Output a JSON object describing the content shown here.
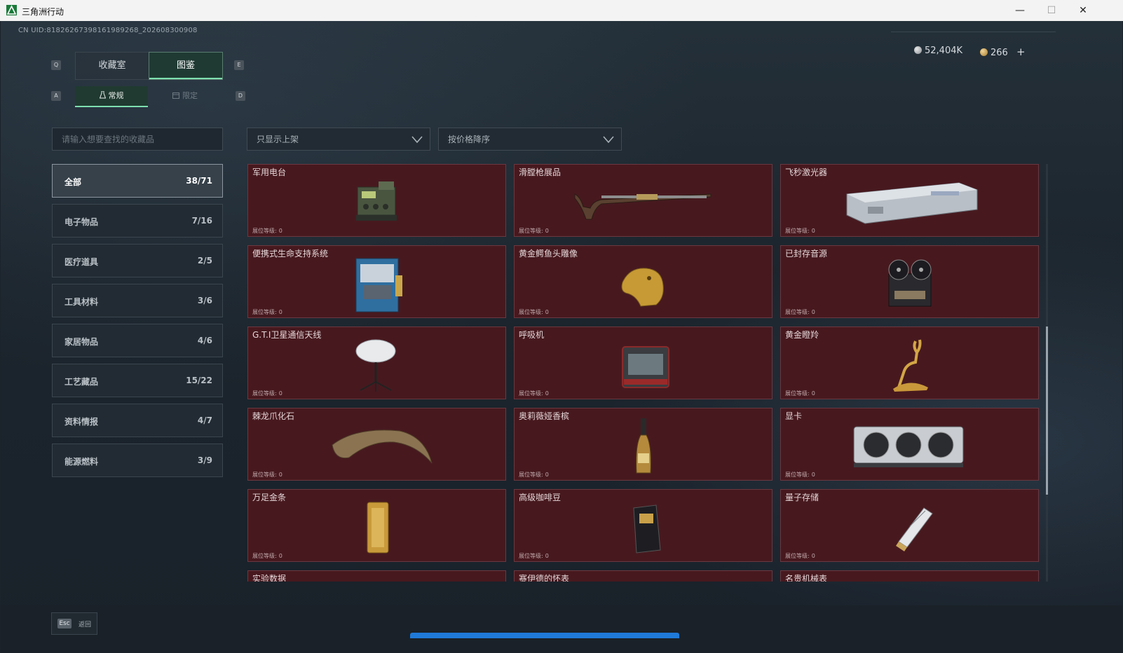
{
  "window": {
    "title": "三角洲行动",
    "minimize": "—",
    "maximize": "☐",
    "close": "✕"
  },
  "header": {
    "uid": "CN UID:818262673981619892​68_202608300908",
    "silver": "52,404K",
    "gold": "266",
    "add": "+"
  },
  "keys": {
    "q": "Q",
    "e": "E",
    "a": "A",
    "d": "D"
  },
  "tabs": [
    {
      "label": "收藏室"
    },
    {
      "label": "图鉴"
    }
  ],
  "subtabs": [
    {
      "label": "常规"
    },
    {
      "label": "限定"
    }
  ],
  "search": {
    "placeholder": "请输入想要查找的收藏品"
  },
  "filters": {
    "shelf": "只显示上架",
    "sort": "按价格降序"
  },
  "categories": [
    {
      "label": "全部",
      "count": "38/71"
    },
    {
      "label": "电子物品",
      "count": "7/16"
    },
    {
      "label": "医疗道具",
      "count": "2/5"
    },
    {
      "label": "工具材料",
      "count": "3/6"
    },
    {
      "label": "家居物品",
      "count": "4/6"
    },
    {
      "label": "工艺藏品",
      "count": "15/22"
    },
    {
      "label": "资料情报",
      "count": "4/7"
    },
    {
      "label": "能源燃料",
      "count": "3/9"
    }
  ],
  "level_label": "展位等级:",
  "items": [
    {
      "name": "军用电台",
      "level": "0"
    },
    {
      "name": "滑膛枪展品",
      "level": "0"
    },
    {
      "name": "飞秒激光器",
      "level": "0"
    },
    {
      "name": "便携式生命支持系统",
      "level": "0"
    },
    {
      "name": "黄金鳄鱼头雕像",
      "level": "0"
    },
    {
      "name": "已封存音源",
      "level": "0"
    },
    {
      "name": "G.T.I卫星通信天线",
      "level": "0"
    },
    {
      "name": "呼吸机",
      "level": "0"
    },
    {
      "name": "黄金瞪羚",
      "level": "0"
    },
    {
      "name": "棘龙爪化石",
      "level": "0"
    },
    {
      "name": "奥莉薇娅香槟",
      "level": "0"
    },
    {
      "name": "显卡",
      "level": "0"
    },
    {
      "name": "万足金条",
      "level": "0"
    },
    {
      "name": "高级咖啡豆",
      "level": "0"
    },
    {
      "name": "量子存储",
      "level": "0"
    },
    {
      "name": "实验数据",
      "level": ""
    },
    {
      "name": "赛伊德的怀表",
      "level": ""
    },
    {
      "name": "名贵机械表",
      "level": ""
    }
  ],
  "footer": {
    "esc_key": "Esc",
    "back": "返回"
  },
  "colors": {
    "card_bg": "#47191f",
    "accent_green": "#7fe0b0",
    "taskbar_blue": "#1f7ad8"
  }
}
